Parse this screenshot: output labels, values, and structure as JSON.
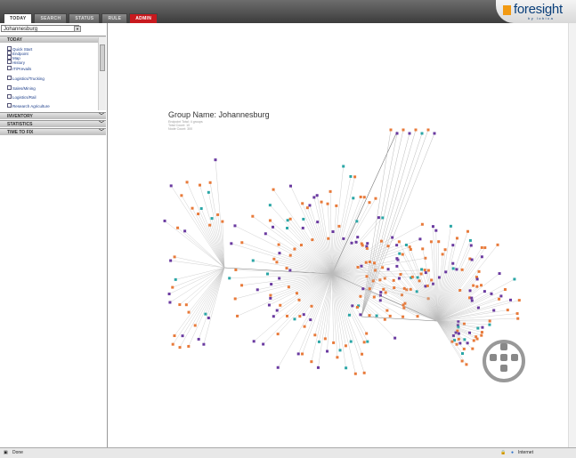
{
  "tabs": [
    "TODAY",
    "SEARCH",
    "STATUS",
    "RULE",
    "ADMIN"
  ],
  "brand": {
    "name": "foresight",
    "sub": "by lobica"
  },
  "location": "Johannesburg",
  "panels": {
    "today": "TODAY",
    "inventory": "INVENTORY",
    "statistics": "STATISTICS",
    "time_to_fix": "TIME TO FIX"
  },
  "today_items": [
    "Quick Start",
    "Endpoint",
    "Map",
    "History",
    "IT/Prevails",
    "Logistics/Trucking",
    "Sales/Mining",
    "Logistics/Rail",
    "Research Agriculture"
  ],
  "graph": {
    "group_title": "Group Name: Johannesburg",
    "meta": [
      "Endpoint Total: 4 groups",
      "Total Count: 10",
      "Node Count: 300"
    ]
  },
  "status": {
    "left": "Done",
    "right": "Internet"
  },
  "colors": {
    "accent_red": "#c8191e",
    "brand_orange": "#f29a13",
    "node_orange": "#e87a3a",
    "node_purple": "#6a3aa0",
    "node_teal": "#2aa6a6"
  }
}
